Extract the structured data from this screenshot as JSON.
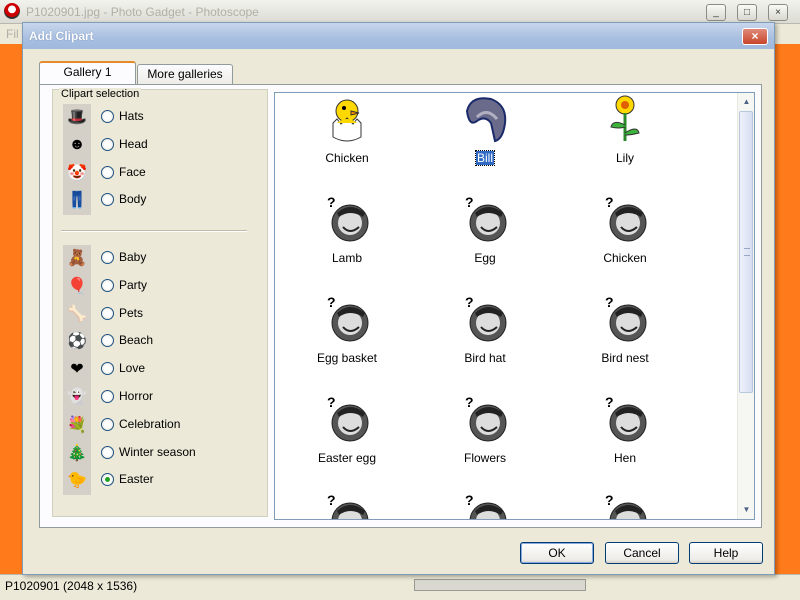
{
  "background_app": {
    "title": "P1020901.jpg - Photo Gadget - Photoscope",
    "menu_first": "Fil",
    "window_buttons": [
      "_",
      "□",
      "×"
    ],
    "status_text": "P1020901 (2048 x 1536)"
  },
  "dialog": {
    "title": "Add Clipart",
    "close_glyph": "×",
    "tabs": [
      {
        "label": "Gallery 1",
        "active": true
      },
      {
        "label": "More galleries",
        "active": false
      }
    ],
    "selection": {
      "legend": "Clipart selection",
      "group1": [
        {
          "label": "Hats",
          "icon": "top-hat-icon",
          "glyph": "🎩",
          "checked": false
        },
        {
          "label": "Head",
          "icon": "head-icon",
          "glyph": "☻",
          "checked": false
        },
        {
          "label": "Face",
          "icon": "clown-face-icon",
          "glyph": "🤡",
          "checked": false
        },
        {
          "label": "Body",
          "icon": "body-icon",
          "glyph": "👖",
          "checked": false
        }
      ],
      "group2": [
        {
          "label": "Baby",
          "icon": "teddy-bear-icon",
          "glyph": "🧸",
          "checked": false
        },
        {
          "label": "Party",
          "icon": "balloon-icon",
          "glyph": "🎈",
          "checked": false
        },
        {
          "label": "Pets",
          "icon": "bone-icon",
          "glyph": "🦴",
          "checked": false
        },
        {
          "label": "Beach",
          "icon": "beach-ball-icon",
          "glyph": "⚽",
          "checked": false
        },
        {
          "label": "Love",
          "icon": "heart-icon",
          "glyph": "❤",
          "checked": false
        },
        {
          "label": "Horror",
          "icon": "ghost-icon",
          "glyph": "👻",
          "checked": false
        },
        {
          "label": "Celebration",
          "icon": "bouquet-icon",
          "glyph": "💐",
          "checked": false
        },
        {
          "label": "Winter season",
          "icon": "christmas-tree-icon",
          "glyph": "🎄",
          "checked": false
        },
        {
          "label": "Easter",
          "icon": "chick-icon",
          "glyph": "🐤",
          "checked": true
        }
      ]
    },
    "gallery": {
      "items": [
        {
          "label": "Chicken",
          "icon": "chick-in-egg-icon",
          "selected": false
        },
        {
          "label": "Bill",
          "icon": "bill-icon",
          "selected": true
        },
        {
          "label": "Lily",
          "icon": "lily-flower-icon",
          "selected": false
        },
        {
          "label": "Lamb",
          "icon": "missing-clipart-icon",
          "selected": false
        },
        {
          "label": "Egg",
          "icon": "missing-clipart-icon",
          "selected": false
        },
        {
          "label": "Chicken",
          "icon": "missing-clipart-icon",
          "selected": false
        },
        {
          "label": "Egg basket",
          "icon": "missing-clipart-icon",
          "selected": false
        },
        {
          "label": "Bird hat",
          "icon": "missing-clipart-icon",
          "selected": false
        },
        {
          "label": "Bird nest",
          "icon": "missing-clipart-icon",
          "selected": false
        },
        {
          "label": "Easter egg",
          "icon": "missing-clipart-icon",
          "selected": false
        },
        {
          "label": "Flowers",
          "icon": "missing-clipart-icon",
          "selected": false
        },
        {
          "label": "Hen",
          "icon": "missing-clipart-icon",
          "selected": false
        }
      ]
    },
    "buttons": {
      "ok": "OK",
      "cancel": "Cancel",
      "help": "Help"
    }
  }
}
